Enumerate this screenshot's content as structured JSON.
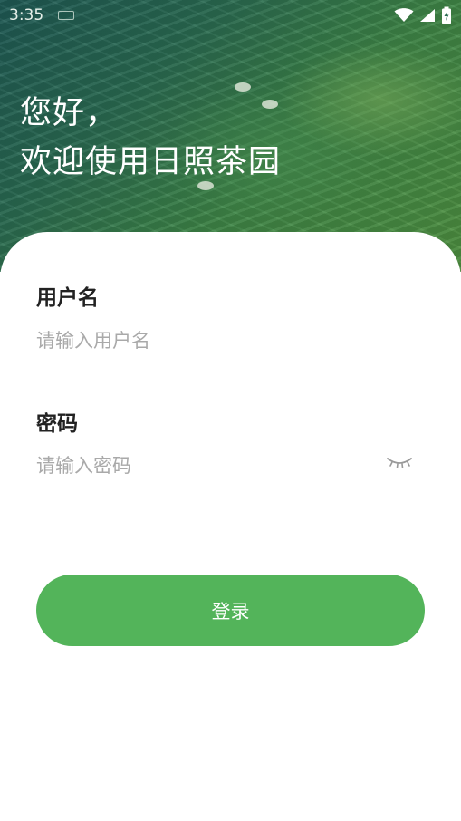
{
  "status_bar": {
    "time": "3:35",
    "icons": [
      "keyboard-icon",
      "wifi-icon",
      "signal-icon",
      "battery-icon"
    ]
  },
  "hero": {
    "greeting_line1": "您好，",
    "greeting_line2": "欢迎使用日照茶园"
  },
  "form": {
    "username": {
      "label": "用户名",
      "placeholder": "请输入用户名",
      "value": ""
    },
    "password": {
      "label": "密码",
      "placeholder": "请输入密码",
      "value": "",
      "toggle_icon": "eye-closed-icon"
    },
    "login_label": "登录"
  },
  "colors": {
    "accent": "#53b45a",
    "hero_dark": "#1f5a55",
    "hero_light": "#4f9140",
    "label_text": "#222222",
    "placeholder_text": "#a9a9a9"
  }
}
